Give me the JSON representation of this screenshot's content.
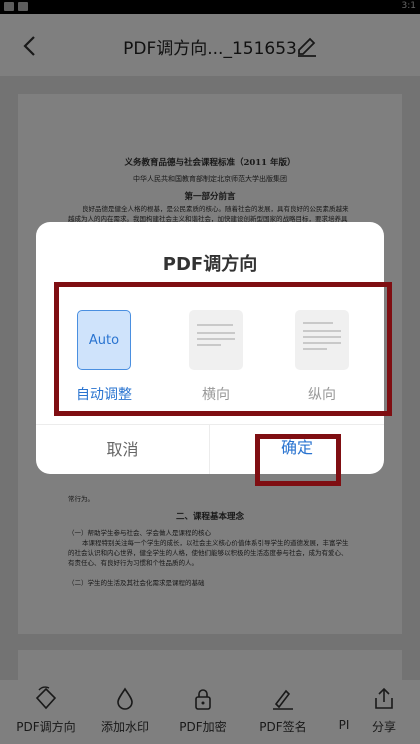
{
  "status_bar": {
    "time": "3:1"
  },
  "app_bar": {
    "title": "PDF调方向..._151653"
  },
  "document": {
    "title": "义务教育品德与社会课程标准（2011 年版）",
    "publisher": "中华人民共和国教育部制定北京师范大学出版集团",
    "section1": "第一部分前言",
    "para1": "良好品德是健全人格的根基，是公民素质的核心。随着社会的发展，具有良好的公民素质越来越成为人的内在需求。我国构建社会主义和谐社会，加快建设创新型国家的战略目标，要求培养具有国家观念和良好品德的公民。",
    "para2": "常行为。",
    "section2": "二、课程基本理念",
    "item1": "（一）帮助学生参与社会、学会做人是课程的核心",
    "para3": "本课程特别关注每一个学生的成长，以社会主义核心价值体系引导学生的道德发展，丰富学生的社会认识和内心世界，健全学生的人格，使他们能够以积极的生活态度参与社会，成为有爱心、有责任心、有良好行为习惯和个性品质的人。",
    "item2": "（二）学生的生活及其社会化需求是课程的基础"
  },
  "dialog": {
    "title": "PDF调方向",
    "options": [
      {
        "label": "自动调整",
        "thumb_text": "Auto",
        "selected": true
      },
      {
        "label": "横向",
        "selected": false
      },
      {
        "label": "纵向",
        "selected": false
      }
    ],
    "cancel_label": "取消",
    "ok_label": "确定"
  },
  "toolbar": {
    "items": [
      {
        "label": "PDF调方向",
        "icon": "rotate-icon"
      },
      {
        "label": "添加水印",
        "icon": "watermark-icon"
      },
      {
        "label": "PDF加密",
        "icon": "lock-icon"
      },
      {
        "label": "PDF签名",
        "icon": "signature-icon"
      },
      {
        "label": "PI",
        "icon": ""
      },
      {
        "label": "分享",
        "icon": "share-icon"
      }
    ]
  },
  "colors": {
    "accent": "#2a74d0",
    "highlight_box": "#7f0e12"
  }
}
